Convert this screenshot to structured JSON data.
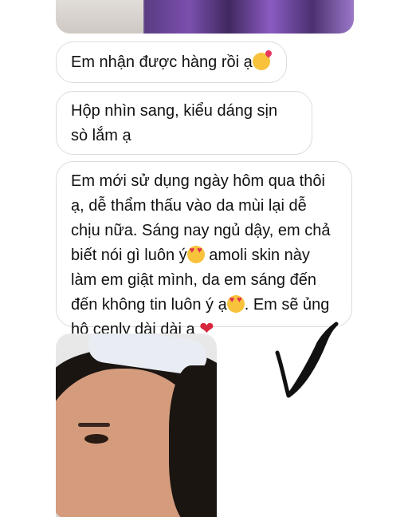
{
  "messages": [
    {
      "text": "Em nhận được hàng rồi ạ",
      "emoji": "kissing-face-with-heart"
    },
    {
      "text": "Hộp nhìn sang, kiểu dáng sịn sò lắm ạ"
    },
    {
      "line1": "Em mới sử dụng ngày hôm qua thôi",
      "line2": "ạ, dễ thẩm thấu vào da mùi lại dễ",
      "line3": "chịu nữa. Sáng nay ngủ dậy, em chả",
      "line4a": "biết nói gì luôn ý",
      "line4b": " amoli skin này",
      "line5": "làm em giật mình, da em sáng đến",
      "line6a": "đến không tin luôn ý ạ",
      "line6b": ". Em sẽ ủng",
      "line7": "hộ cenly dài dài ạ",
      "emojis": [
        "heart-eyes",
        "heart-eyes",
        "red-heart"
      ]
    }
  ],
  "colors": {
    "bubble_border": "#dcdcdc",
    "text": "#111111",
    "heart": "#d7263d"
  }
}
